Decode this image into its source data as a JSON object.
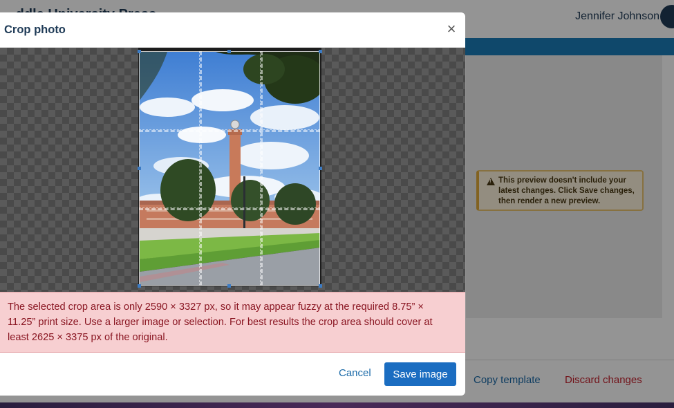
{
  "app": {
    "title": "...ddle University Press",
    "user_name": "Jennifer Johnson",
    "preview_warning": "This preview doesn't include your latest changes. Click Save changes, then render a new preview.",
    "footer": {
      "copy_template": "Copy template",
      "discard_changes": "Discard changes"
    }
  },
  "modal": {
    "title": "Crop photo",
    "close_icon": "×",
    "alert_text": "The selected crop area is only 2590 × 3327 px, so it may appear fuzzy at the required 8.75” × 11.25” print size. Use a larger image or selection. For best results the crop area should cover at least 2625 × 3375 px of the original.",
    "cancel_label": "Cancel",
    "save_label": "Save image"
  },
  "colors": {
    "brand_bar": "#1b7db8",
    "primary_button": "#1b6dc1",
    "alert_background": "#f7cfd1",
    "alert_text": "#8a1622",
    "warning_border": "#e0a93a"
  }
}
